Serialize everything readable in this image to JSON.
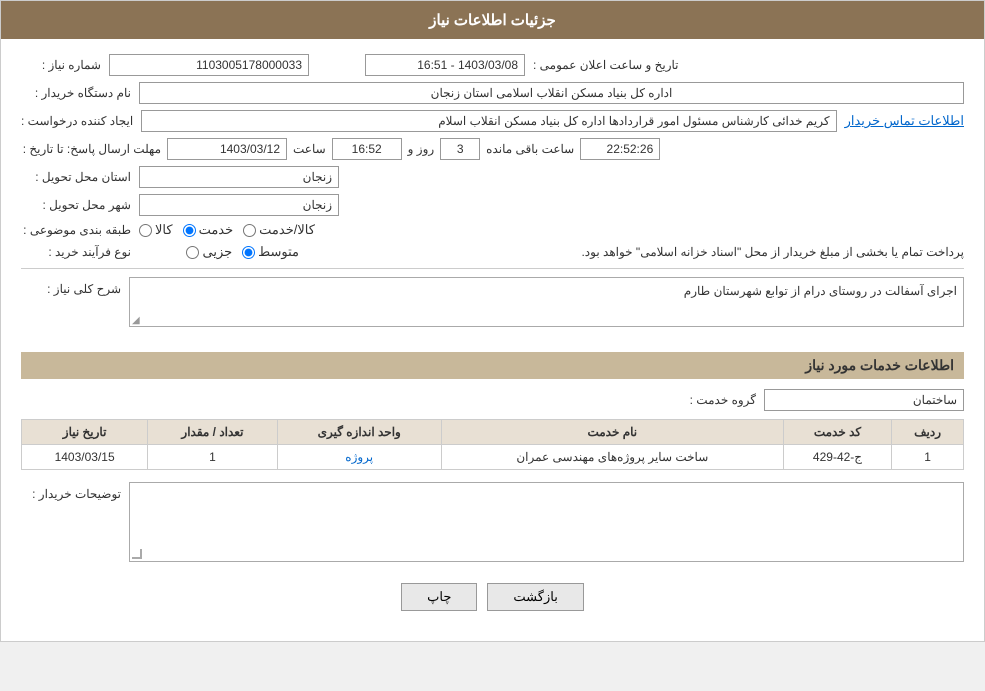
{
  "header": {
    "title": "جزئیات اطلاعات نیاز"
  },
  "fields": {
    "need_number_label": "شماره نیاز :",
    "need_number_value": "1103005178000033",
    "announce_date_label": "تاریخ و ساعت اعلان عمومی :",
    "announce_date_value": "1403/03/08 - 16:51",
    "buyer_org_label": "نام دستگاه خریدار :",
    "buyer_org_value": "اداره کل بنیاد مسکن انقلاب اسلامی استان زنجان",
    "requester_label": "ایجاد کننده درخواست :",
    "requester_value": "کریم خدائی کارشناس مسئول امور قراردادها اداره کل بنیاد مسکن انقلاب اسلام",
    "requester_link": "اطلاعات تماس خریدار",
    "response_deadline_label": "مهلت ارسال پاسخ: تا تاریخ :",
    "response_date": "1403/03/12",
    "response_time_label": "ساعت",
    "response_time": "16:52",
    "response_days_label": "روز و",
    "response_days": "3",
    "response_remaining_label": "ساعت باقی مانده",
    "response_remaining": "22:52:26",
    "province_label": "استان محل تحویل :",
    "province_value": "زنجان",
    "city_label": "شهر محل تحویل :",
    "city_value": "زنجان",
    "category_label": "طبقه بندی موضوعی :",
    "category_options": [
      "کالا",
      "خدمت",
      "کالا/خدمت"
    ],
    "category_selected": "خدمت",
    "purchase_type_label": "نوع فرآیند خرید :",
    "purchase_type_options": [
      "جزیی",
      "متوسط"
    ],
    "purchase_type_selected": "متوسط",
    "purchase_type_desc": "پرداخت تمام یا بخشی از مبلغ خریدار از محل \"اسناد خزانه اسلامی\" خواهد بود.",
    "need_desc_label": "شرح کلی نیاز :",
    "need_desc_value": "اجرای آسفالت در روستای    درام از توابع شهرستان طارم",
    "service_info_title": "اطلاعات خدمات مورد نیاز",
    "service_group_label": "گروه خدمت :",
    "service_group_value": "ساختمان",
    "table": {
      "headers": [
        "ردیف",
        "کد خدمت",
        "نام خدمت",
        "واحد اندازه گیری",
        "تعداد / مقدار",
        "تاریخ نیاز"
      ],
      "rows": [
        {
          "row": "1",
          "code": "ج-42-429",
          "name": "ساخت سایر پروژه‌های مهندسی عمران",
          "unit": "پروژه",
          "quantity": "1",
          "date": "1403/03/15"
        }
      ]
    },
    "buyer_comments_label": "توضیحات خریدار :",
    "buyer_comments_value": ""
  },
  "buttons": {
    "print": "چاپ",
    "back": "بازگشت"
  }
}
